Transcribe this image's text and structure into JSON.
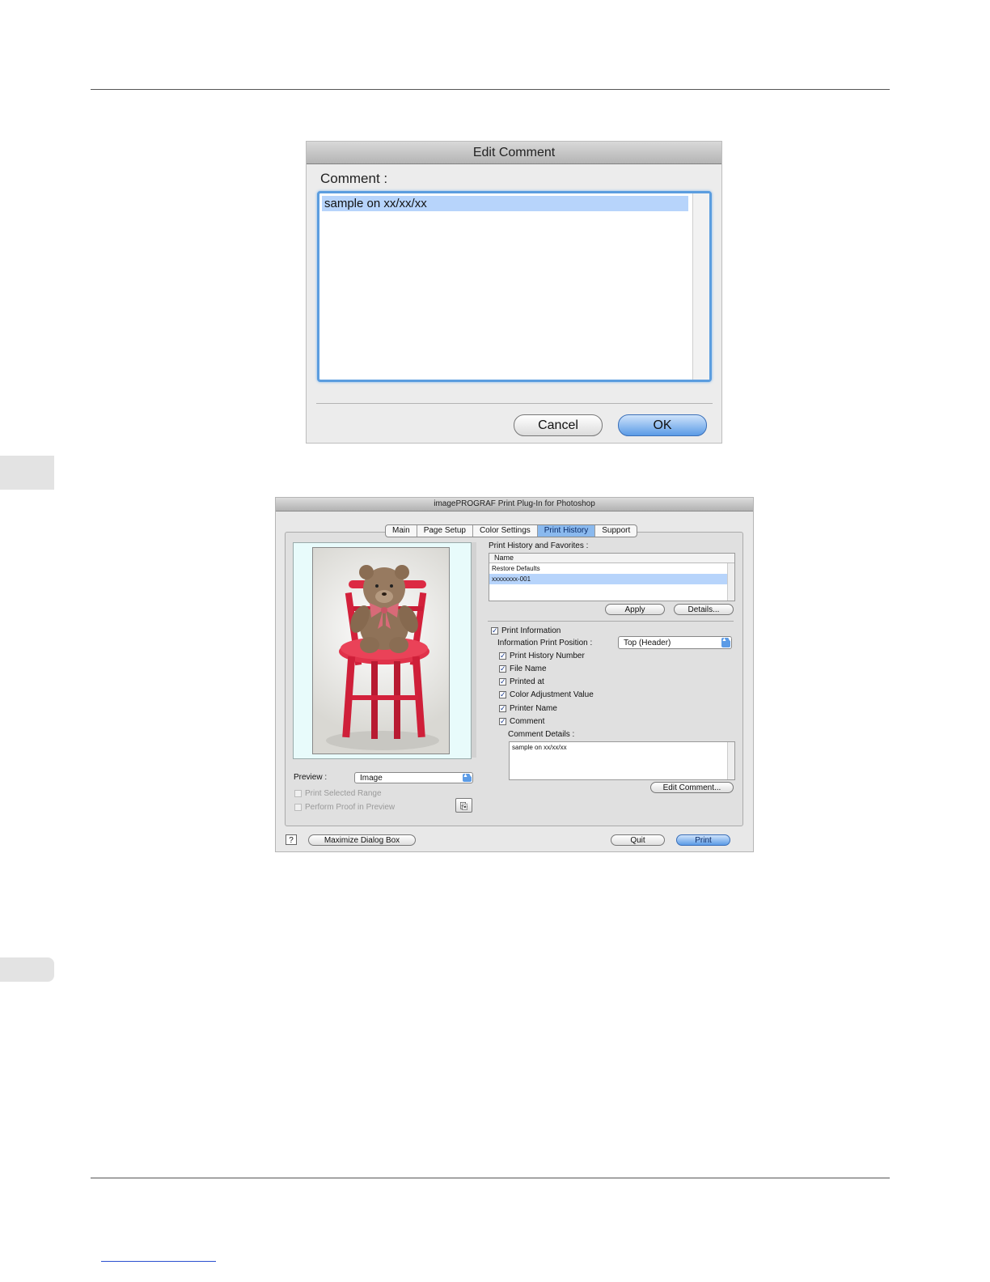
{
  "edit_comment_dialog": {
    "title": "Edit Comment",
    "comment_label": "Comment :",
    "comment_value": "sample on xx/xx/xx",
    "cancel_label": "Cancel",
    "ok_label": "OK"
  },
  "plugin_dialog": {
    "title": "imagePROGRAF Print Plug-In for Photoshop",
    "tabs": [
      {
        "label": "Main",
        "active": false
      },
      {
        "label": "Page Setup",
        "active": false
      },
      {
        "label": "Color Settings",
        "active": false
      },
      {
        "label": "Print History",
        "active": true
      },
      {
        "label": "Support",
        "active": false
      }
    ],
    "history": {
      "label": "Print History and Favorites :",
      "column_name": "Name",
      "rows": [
        {
          "name": "Restore Defaults",
          "selected": false
        },
        {
          "name": "xxxxxxxx-001",
          "selected": true
        }
      ],
      "apply_label": "Apply",
      "details_label": "Details..."
    },
    "print_information": {
      "label": "Print Information",
      "checked": true,
      "position_label": "Information Print Position :",
      "position_value": "Top (Header)",
      "items": [
        {
          "label": "Print History Number",
          "checked": true
        },
        {
          "label": "File Name",
          "checked": true
        },
        {
          "label": "Printed at",
          "checked": true
        },
        {
          "label": "Color Adjustment Value",
          "checked": true
        },
        {
          "label": "Printer Name",
          "checked": true
        },
        {
          "label": "Comment",
          "checked": true
        }
      ],
      "comment_details_label": "Comment Details :",
      "comment_details_value": "sample on xx/xx/xx",
      "edit_comment_label": "Edit Comment..."
    },
    "preview": {
      "label": "Preview :",
      "value": "Image",
      "print_selected_range": "Print Selected Range",
      "perform_proof": "Perform Proof in Preview"
    },
    "footer": {
      "help_glyph": "?",
      "maximize_label": "Maximize Dialog Box",
      "quit_label": "Quit",
      "print_label": "Print"
    }
  },
  "icons": {
    "check": "✓",
    "popup_arrows": "▲▼",
    "proof_icon": "⎘"
  },
  "colors": {
    "accent": "#5b9be6",
    "selection": "#b7d4fb"
  }
}
